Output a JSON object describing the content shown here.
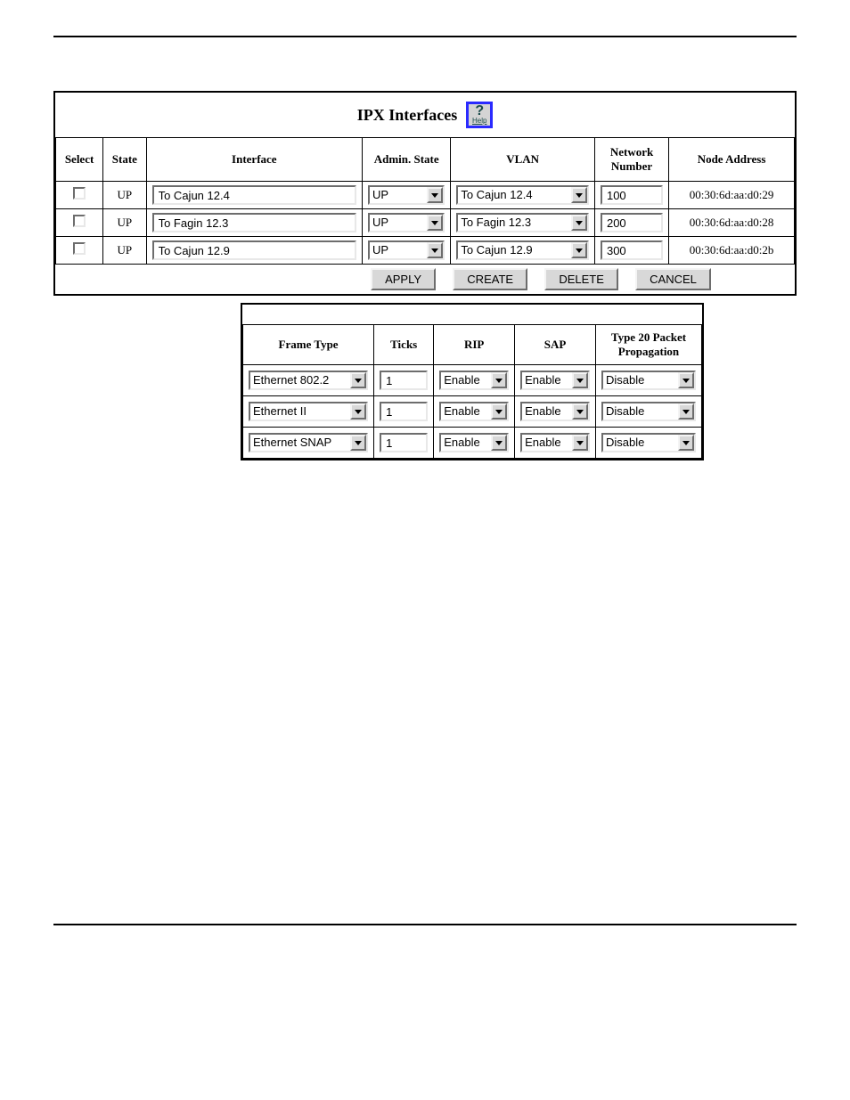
{
  "title": "IPX Interfaces",
  "help_label": "Help",
  "headers": {
    "select": "Select",
    "state": "State",
    "interface": "Interface",
    "admin_state": "Admin. State",
    "vlan": "VLAN",
    "network_number": "Network Number",
    "node_address": "Node Address"
  },
  "rows": [
    {
      "state": "UP",
      "interface": "To Cajun 12.4",
      "admin": "UP",
      "vlan": "To Cajun 12.4",
      "net": "100",
      "node": "00:30:6d:aa:d0:29"
    },
    {
      "state": "UP",
      "interface": "To Fagin 12.3",
      "admin": "UP",
      "vlan": "To Fagin 12.3",
      "net": "200",
      "node": "00:30:6d:aa:d0:28"
    },
    {
      "state": "UP",
      "interface": "To Cajun 12.9",
      "admin": "UP",
      "vlan": "To Cajun 12.9",
      "net": "300",
      "node": "00:30:6d:aa:d0:2b"
    }
  ],
  "buttons": {
    "apply": "APPLY",
    "create": "CREATE",
    "delete": "DELETE",
    "cancel": "CANCEL"
  },
  "headers2": {
    "frame_type": "Frame Type",
    "ticks": "Ticks",
    "rip": "RIP",
    "sap": "SAP",
    "type20": "Type 20 Packet Propagation"
  },
  "rows2": [
    {
      "frame": "Ethernet 802.2",
      "ticks": "1",
      "rip": "Enable",
      "sap": "Enable",
      "t20": "Disable"
    },
    {
      "frame": "Ethernet II",
      "ticks": "1",
      "rip": "Enable",
      "sap": "Enable",
      "t20": "Disable"
    },
    {
      "frame": "Ethernet SNAP",
      "ticks": "1",
      "rip": "Enable",
      "sap": "Enable",
      "t20": "Disable"
    }
  ]
}
